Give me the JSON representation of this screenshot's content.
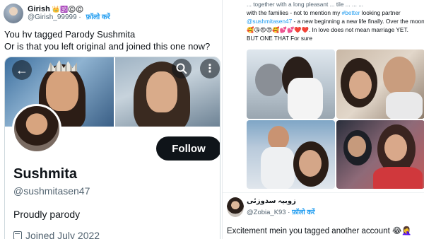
{
  "left_tweet": {
    "author_name": "Girish",
    "author_emojis": "👑🕉️©️©️",
    "author_handle": "@Girish_99999",
    "follow_label": "फ़ॉलो करें",
    "text_line1": "You hv tagged Parody Sushmita",
    "text_line2": "Or is that you left original and joined this one now?"
  },
  "profile_card": {
    "back_glyph": "←",
    "more_glyph": "⋮",
    "follow_button": "Follow",
    "display_name": "Sushmita",
    "handle": "@sushmitasen47",
    "bio": "Proudly parody",
    "joined": "Joined July 2022"
  },
  "right_tweet": {
    "line0": "...  together with a long pleasant ... tile  ...  ... ...",
    "line1_a": "with the families - not to mention my ",
    "line1_b": "#better",
    "line1_c": " looking partner",
    "line2_mention": "@sushmitasen47",
    "line2_rest": " - a new beginning a new life finally. Over the moon",
    "line3_emojis": "🥰😘😍😍🥰💕💕❤️❤️",
    "line3_rest": ". In love does not mean marriage YET.",
    "line4": "BUT ONE THAT For sure"
  },
  "reply": {
    "author_name": "زوبیہ سدوزئی",
    "author_handle": "@Zobia_K93",
    "follow_label": "फ़ॉलो करें",
    "text": "Excitement mein you tagged another account 😂🤦‍♀️"
  },
  "colors": {
    "link_blue": "#1d9bf0",
    "text_dark": "#0f1419",
    "text_gray": "#536471",
    "follow_btn_bg": "#0f1419"
  }
}
